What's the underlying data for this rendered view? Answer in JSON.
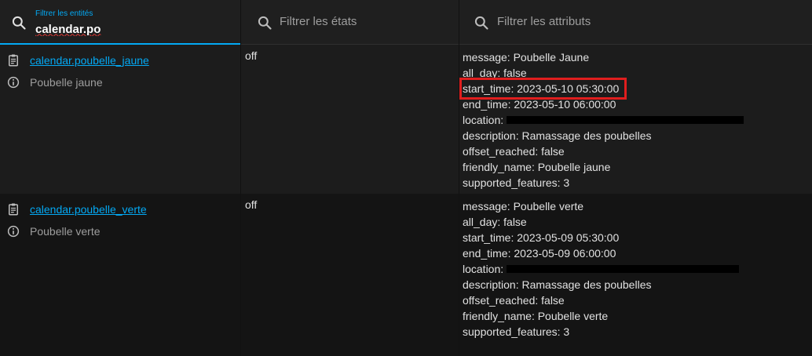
{
  "filters": {
    "entities": {
      "label": "Filtrer les entités",
      "value": "calendar.po",
      "icon": "search-icon"
    },
    "states": {
      "placeholder": "Filtrer les états",
      "icon": "search-icon"
    },
    "attributes": {
      "placeholder": "Filtrer les attributs",
      "icon": "search-icon"
    }
  },
  "rows": [
    {
      "entity_id": "calendar.poubelle_jaune",
      "friendly_name": "Poubelle jaune",
      "state": "off",
      "attributes": [
        "message: Poubelle Jaune",
        "all_day: false",
        "start_time: 2023-05-10 05:30:00",
        "end_time: 2023-05-10 06:00:00",
        "location:",
        "description: Ramassage des poubelles",
        "offset_reached: false",
        "friendly_name: Poubelle jaune",
        "supported_features: 3"
      ]
    },
    {
      "entity_id": "calendar.poubelle_verte",
      "friendly_name": "Poubelle verte",
      "state": "off",
      "attributes": [
        "message: Poubelle verte",
        "all_day: false",
        "start_time: 2023-05-09 05:30:00",
        "end_time: 2023-05-09 06:00:00",
        "location:",
        "description: Ramassage des poubelles",
        "offset_reached: false",
        "friendly_name: Poubelle verte",
        "supported_features: 3"
      ]
    }
  ],
  "colors": {
    "accent": "#03a9f4",
    "highlight_box": "#e01e1e",
    "redaction": "#000000"
  }
}
